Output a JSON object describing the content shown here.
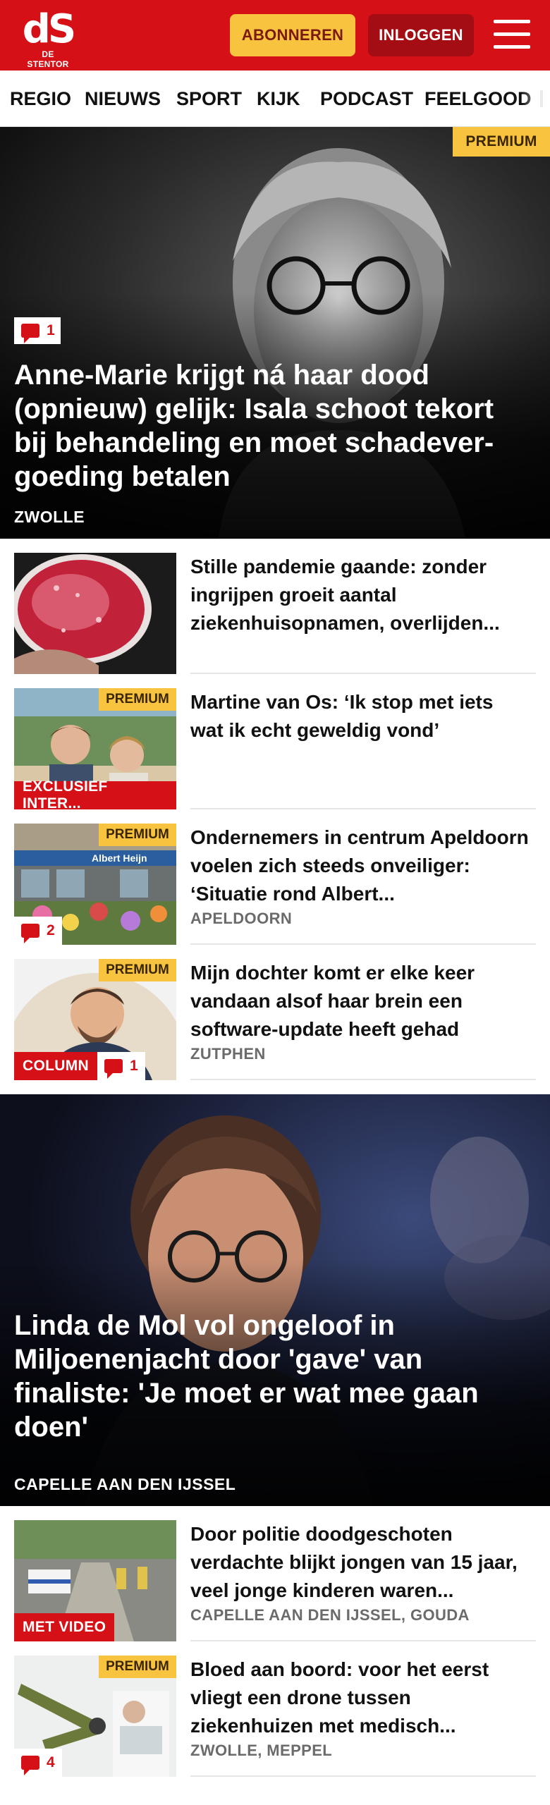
{
  "brand": {
    "logo_mark": "dS",
    "logo_sub": "DE STENTOR"
  },
  "header": {
    "subscribe_label": "ABONNEREN",
    "login_label": "INLOGGEN"
  },
  "nav": {
    "items": [
      "REGIO",
      "NIEUWS",
      "SPORT",
      "KIJK",
      "PODCAST",
      "FEELGOOD"
    ]
  },
  "hero1": {
    "premium_label": "PREMIUM",
    "comments": "1",
    "title": "Anne-Marie krijgt ná haar dood (opnieuw) gelijk: Isala schoot tekort bij behandeling en moet schadever-goeding betalen",
    "location": "ZWOLLE"
  },
  "articles1": [
    {
      "title": "Stille pandemie gaande: zonder ingrijpen groeit aantal ziekenhuisopnamen, overlijden..."
    },
    {
      "title": "Martine van Os: ‘Ik stop met iets wat ik echt geweldig vond’",
      "premium": "PREMIUM",
      "label": "EXCLUSIEF INTER..."
    },
    {
      "title": "Ondernemers in centrum Apeldoorn voelen zich steeds onveiliger: ‘Situatie rond Albert...",
      "premium": "PREMIUM",
      "comments": "2",
      "location": "APELDOORN",
      "shop_sign": "Albert Heijn"
    },
    {
      "title": "Mijn dochter komt er elke keer vandaan alsof haar brein een software-update heeft gehad",
      "premium": "PREMIUM",
      "label": "COLUMN",
      "comments": "1",
      "location": "ZUTPHEN"
    }
  ],
  "hero2": {
    "title": "Linda de Mol vol ongeloof in Miljoenenjacht door 'gave' van finaliste: 'Je moet er wat mee gaan doen'",
    "location": "CAPELLE AAN DEN IJSSEL"
  },
  "articles2": [
    {
      "title": "Door politie doodgeschoten verdachte blijkt jongen van 15 jaar, veel jonge kinderen waren...",
      "label": "MET VIDEO",
      "location": "CAPELLE AAN DEN IJSSEL, GOUDA"
    },
    {
      "title": "Bloed aan boord: voor het eerst vliegt een drone tussen ziekenhuizen met medisch...",
      "premium": "PREMIUM",
      "comments": "4",
      "location": "ZWOLLE, MEPPEL"
    }
  ],
  "colors": {
    "brand_red": "#d51017",
    "premium_yellow": "#f8c33f",
    "login_dark_red": "#a40d13"
  },
  "icons": [
    "menu-icon",
    "comment-icon"
  ]
}
